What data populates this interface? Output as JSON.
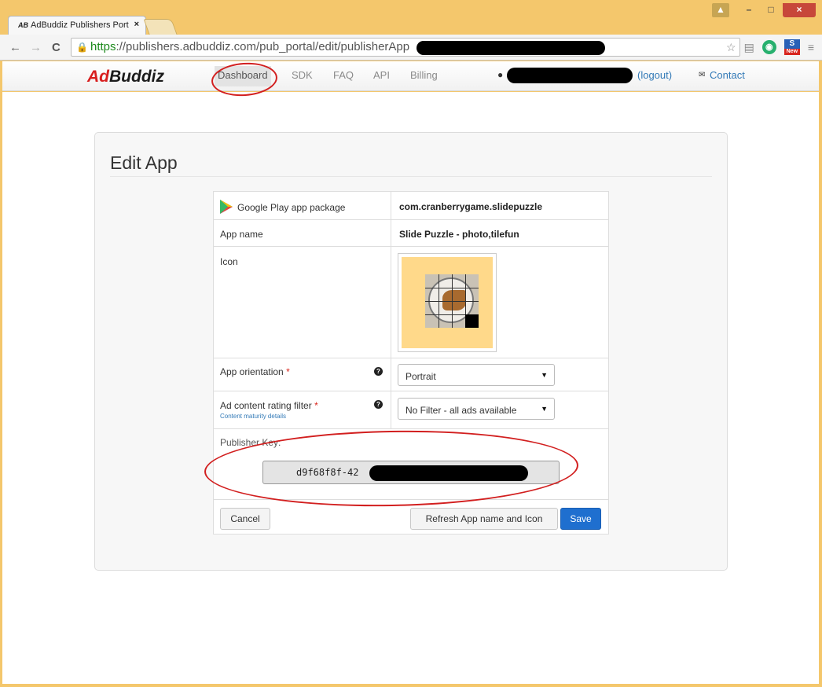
{
  "browser": {
    "tab_title": "AdBuddiz Publishers Port",
    "tab_favicon": "AB",
    "tab_close": "×",
    "url_scheme": "https",
    "url_rest": "://publishers.adbuddiz.com/pub_portal/edit/publisherApp",
    "back_icon": "←",
    "forward_icon": "→",
    "reload_icon": "C",
    "window_buttons": {
      "minimize": "–",
      "maximize": "□",
      "close": "×"
    },
    "ext_new_label": "New"
  },
  "nav": {
    "brand_ad": "Ad",
    "brand_buddiz": "Buddiz",
    "links": [
      "Dashboard",
      "SDK",
      "FAQ",
      "API",
      "Billing"
    ],
    "logout": "(logout)",
    "contact": "Contact"
  },
  "panel": {
    "title": "Edit App"
  },
  "form": {
    "package_label": "Google Play app package",
    "package_value": "com.cranberrygame.slidepuzzle",
    "app_name_label": "App name",
    "app_name_value": "Slide Puzzle - photo,tilefun",
    "icon_label": "Icon",
    "orientation_label": "App orientation",
    "orientation_value": "Portrait",
    "rating_label": "Ad content rating filter",
    "rating_value": "No Filter - all ads available",
    "rating_sublink": "Content maturity details",
    "required_mark": "*",
    "help_glyph": "?",
    "publisher_key_label": "Publisher Key:",
    "publisher_key_value": "d9f68f8f-42"
  },
  "buttons": {
    "cancel": "Cancel",
    "refresh": "Refresh App name and Icon",
    "save": "Save"
  },
  "colors": {
    "accent": "#1f6fcf",
    "brand_red": "#d81e1e",
    "annotation": "#d21f1f"
  }
}
